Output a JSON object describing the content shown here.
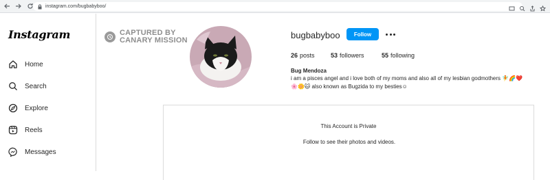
{
  "browser": {
    "url": "instagram.com/bugbabyboo/",
    "icons": [
      "back-icon",
      "forward-icon",
      "reload-icon",
      "lock-icon",
      "cast-icon",
      "zoom-icon",
      "share-icon",
      "bookmark-icon"
    ]
  },
  "sidebar": {
    "logo": "Instagram",
    "items": [
      {
        "label": "Home",
        "icon": "home-icon"
      },
      {
        "label": "Search",
        "icon": "search-icon"
      },
      {
        "label": "Explore",
        "icon": "compass-icon"
      },
      {
        "label": "Reels",
        "icon": "reels-icon"
      },
      {
        "label": "Messages",
        "icon": "messenger-icon"
      }
    ]
  },
  "watermark": {
    "line1": "CAPTURED BY",
    "line2": "CANARY MISSION"
  },
  "profile": {
    "username": "bugbabyboo",
    "follow_label": "Follow",
    "stats": [
      {
        "value": "26",
        "label": "posts"
      },
      {
        "value": "53",
        "label": "followers"
      },
      {
        "value": "55",
        "label": "following"
      }
    ],
    "full_name": "Bug Mendoza",
    "bio_line1": "i am a pisces angel and i love both of my moms and also all of my lesbian godmothers 🧚🌈❤️",
    "bio_line2": "🌸🌼🐱 also known as Bugzida to my besties☺"
  },
  "private": {
    "title": "This Account is Private",
    "subtitle": "Follow to see their photos and videos."
  },
  "colors": {
    "accent": "#0095f6",
    "border": "#dbdbdb",
    "watermark": "#8e8e8e"
  }
}
